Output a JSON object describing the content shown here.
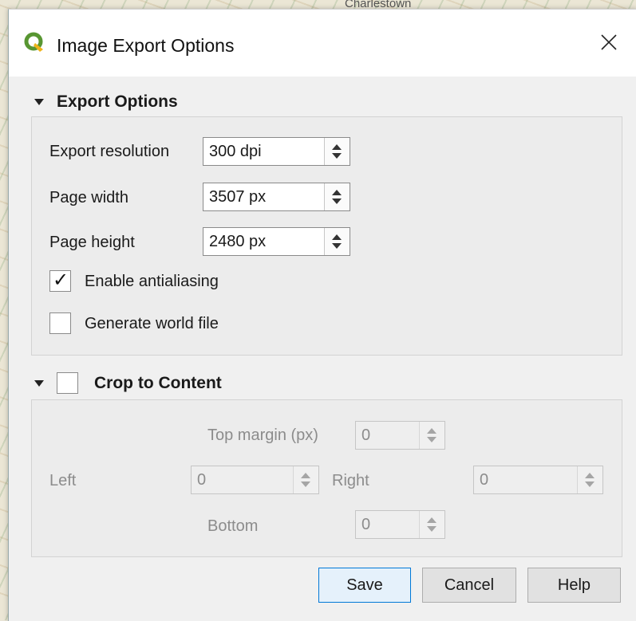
{
  "background": {
    "map_label": "Charlestown"
  },
  "dialog": {
    "title": "Image Export Options",
    "colors": {
      "accent": "#0078d7",
      "icon_green": "#589632",
      "icon_yellow": "#f0b31a"
    }
  },
  "export_options": {
    "header": "Export Options",
    "resolution": {
      "label": "Export resolution",
      "value": "300 dpi"
    },
    "page_width": {
      "label": "Page width",
      "value": "3507 px"
    },
    "page_height": {
      "label": "Page height",
      "value": "2480 px"
    },
    "antialiasing": {
      "label": "Enable antialiasing",
      "checked": true
    },
    "world_file": {
      "label": "Generate world file",
      "checked": false
    }
  },
  "crop": {
    "header": "Crop to Content",
    "checked": false,
    "top": {
      "label": "Top margin (px)",
      "value": "0"
    },
    "left": {
      "label": "Left",
      "value": "0"
    },
    "right": {
      "label": "Right",
      "value": "0"
    },
    "bottom": {
      "label": "Bottom",
      "value": "0"
    }
  },
  "buttons": {
    "save": "Save",
    "cancel": "Cancel",
    "help": "Help"
  }
}
